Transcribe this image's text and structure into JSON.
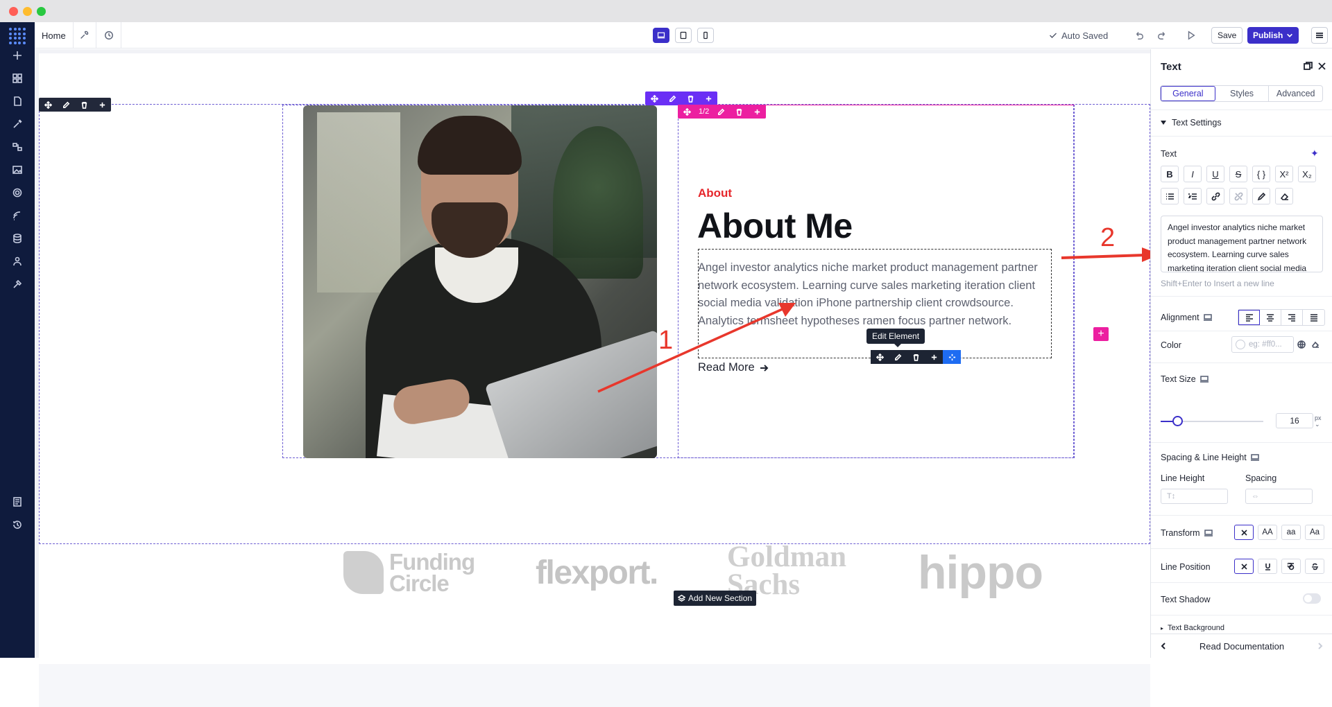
{
  "topbar": {
    "home_tab": "Home",
    "auto_saved": "Auto Saved",
    "save_label": "Save",
    "publish_label": "Publish"
  },
  "canvas": {
    "column_toolbar_label": "1/2",
    "about_kicker": "About",
    "about_title": "About Me",
    "body_text": "Angel investor analytics niche market product management partner network ecosystem. Learning curve sales marketing iteration client social media validation iPhone partnership client crowdsource. Analytics termsheet hypotheses ramen focus partner network.",
    "read_more": "Read More",
    "edit_tooltip": "Edit Element",
    "add_section": "Add New Section",
    "logos": {
      "funding_circle_line1": "Funding",
      "funding_circle_line2": "Circle",
      "flexport": "flexport.",
      "goldman_line1": "Goldman",
      "goldman_line2": "Sachs",
      "hippo": "hippo"
    }
  },
  "annotations": {
    "label_1": "1",
    "label_2": "2",
    "color": "#e8372c"
  },
  "panel": {
    "title": "Text",
    "tabs": [
      "General",
      "Styles",
      "Advanced"
    ],
    "active_tab": "General",
    "group_title": "Text Settings",
    "text_label": "Text",
    "text_value": "Angel investor analytics niche market product management partner network ecosystem. Learning curve sales marketing iteration client social media",
    "hint": "Shift+Enter to Insert a new line",
    "alignment_label": "Alignment",
    "color_label": "Color",
    "color_placeholder": "eg: #ff0...",
    "text_size_label": "Text Size",
    "text_size_value": "16",
    "text_size_unit_top": "px",
    "spacing_label": "Spacing & Line Height",
    "line_height_label": "Line Height",
    "spacing_sub_label": "Spacing",
    "transform_label": "Transform",
    "transform_options": [
      "AA",
      "aa",
      "Aa"
    ],
    "line_position_label": "Line Position",
    "text_shadow_label": "Text Shadow",
    "text_background_label": "Text Background",
    "footer_label": "Read Documentation"
  },
  "colors": {
    "accent": "#3b2fc9",
    "sidebar": "#0f1b3d",
    "kicker_red": "#e6262b",
    "pink": "#ec1fa0",
    "purple": "#6a2ff5"
  }
}
